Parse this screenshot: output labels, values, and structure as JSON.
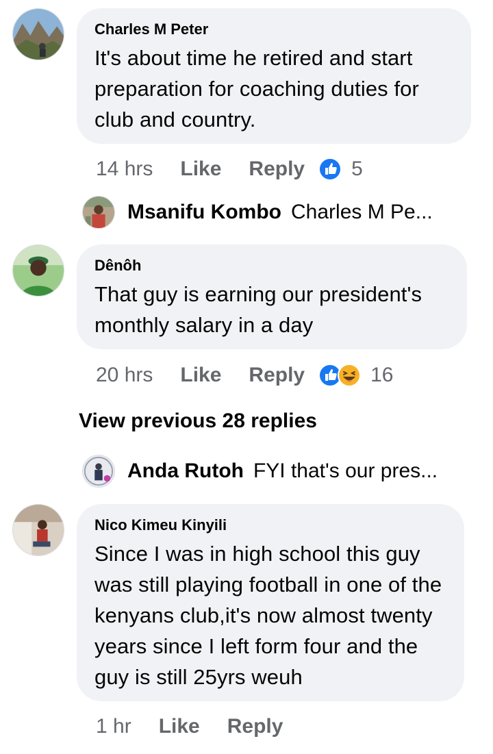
{
  "comments": [
    {
      "author": "Charles M Peter",
      "text": "It's about time he retired and start preparation for coaching duties for club and country.",
      "time": "14 hrs",
      "like_label": "Like",
      "reply_label": "Reply",
      "reaction_count": "5",
      "reactions": [
        "like"
      ]
    },
    {
      "author": "Dênôh",
      "text": "That guy is earning our president's monthly salary in a day",
      "time": "20 hrs",
      "like_label": "Like",
      "reply_label": "Reply",
      "reaction_count": "16",
      "reactions": [
        "like",
        "haha"
      ]
    },
    {
      "author": "Nico Kimeu Kinyili",
      "text": "Since I was in high school this guy was still playing football in one of the kenyans club,it's now almost twenty years since I left form four and the guy is still 25yrs weuh",
      "time": "1 hr",
      "like_label": "Like",
      "reply_label": "Reply"
    }
  ],
  "reply_previews": [
    {
      "name": "Msanifu Kombo",
      "snippet": "Charles M Pe..."
    },
    {
      "name": "Anda Rutoh",
      "snippet": "FYI that's our pres..."
    }
  ],
  "view_previous_label": "View previous 28 replies",
  "colors": {
    "bubble": "#f0f2f5",
    "secondary_text": "#65676b",
    "like_blue": "#1877f2",
    "haha_yellow": "#f7b125"
  }
}
